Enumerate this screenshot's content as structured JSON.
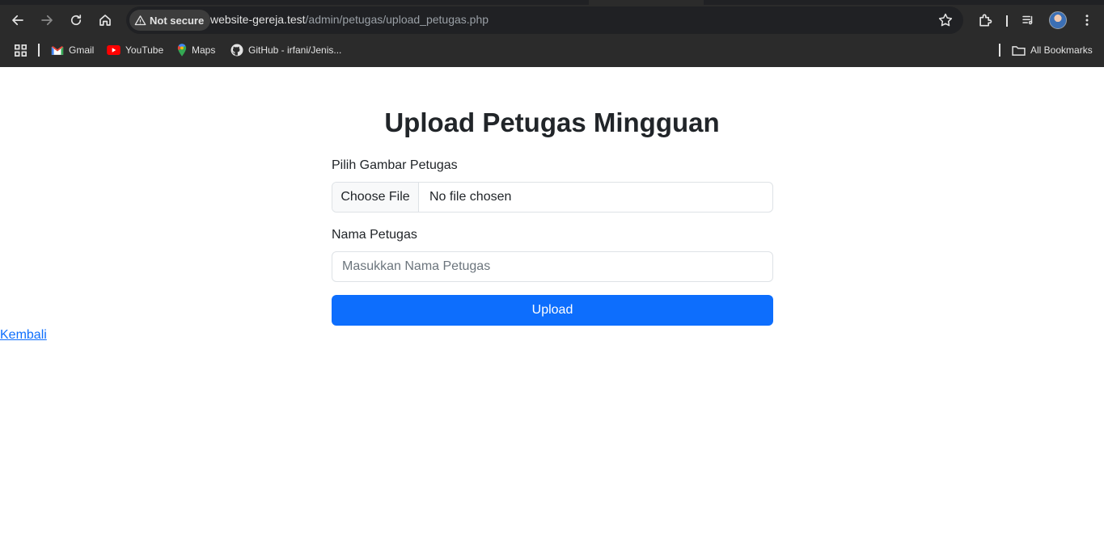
{
  "browser": {
    "security_label": "Not secure",
    "url_host": "website-gereja.test",
    "url_path": "/admin/petugas/upload_petugas.php",
    "bookmarks": [
      {
        "label": "Gmail",
        "icon": "gmail-icon"
      },
      {
        "label": "YouTube",
        "icon": "youtube-icon"
      },
      {
        "label": "Maps",
        "icon": "maps-icon"
      },
      {
        "label": "GitHub - irfani/Jenis...",
        "icon": "github-icon"
      }
    ],
    "all_bookmarks_label": "All Bookmarks"
  },
  "page": {
    "title": "Upload Petugas Mingguan",
    "file_label": "Pilih Gambar Petugas",
    "file_button": "Choose File",
    "file_status": "No file chosen",
    "name_label": "Nama Petugas",
    "name_placeholder": "Masukkan Nama Petugas",
    "submit_label": "Upload",
    "back_link": "Kembali"
  },
  "colors": {
    "primary": "#0d6efd",
    "chrome_bg": "#2b2b2b",
    "text": "#212529"
  }
}
